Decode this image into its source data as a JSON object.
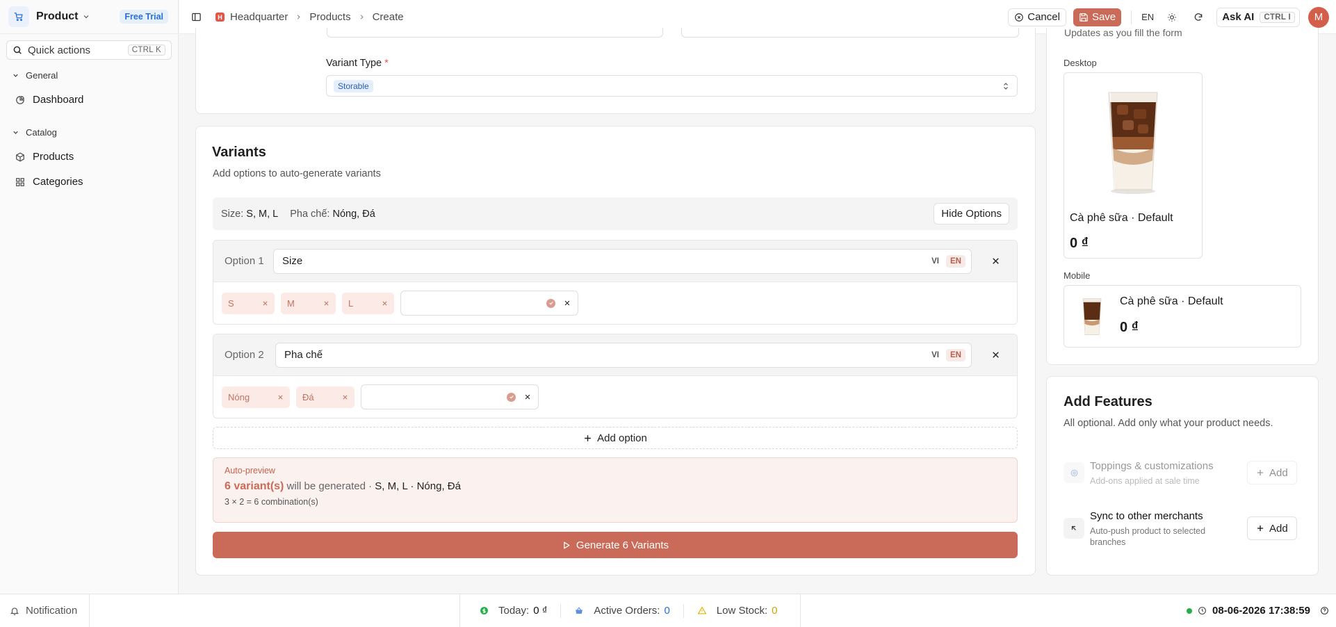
{
  "sidebar": {
    "brand": "Product",
    "trial_badge": "Free Trial",
    "quick_actions": "Quick actions",
    "quick_kbd": "CTRL K",
    "sections": [
      {
        "label": "General",
        "items": [
          {
            "label": "Dashboard",
            "icon": "pie-chart-icon"
          }
        ]
      },
      {
        "label": "Catalog",
        "items": [
          {
            "label": "Products",
            "icon": "box-icon"
          },
          {
            "label": "Categories",
            "icon": "grid-icon"
          }
        ]
      }
    ]
  },
  "topbar": {
    "breadcrumb": [
      "Headquarter",
      "Products",
      "Create"
    ],
    "hq_badge": "H",
    "cancel": "Cancel",
    "save": "Save",
    "lang": "EN",
    "ask_ai": "Ask AI",
    "ask_kbd": "CTRL I",
    "avatar": "M"
  },
  "form": {
    "variant_type_label": "Variant Type",
    "required_mark": "*",
    "variant_type_value": "Storable"
  },
  "variants": {
    "title": "Variants",
    "subtitle": "Add options to auto-generate variants",
    "summary": [
      {
        "name": "Size:",
        "values": "S, M, L"
      },
      {
        "name": "Pha chế:",
        "values": "Nóng, Đá"
      }
    ],
    "hide_options": "Hide Options",
    "options": [
      {
        "label": "Option 1",
        "name": "Size",
        "values": [
          "S",
          "M",
          "L"
        ]
      },
      {
        "label": "Option 2",
        "name": "Pha chế",
        "values": [
          "Nóng",
          "Đá"
        ]
      }
    ],
    "lang_tabs": [
      "VI",
      "EN"
    ],
    "add_option": "Add option",
    "preview": {
      "title": "Auto-preview",
      "count": "6 variant(s)",
      "middle": "will be generated ·",
      "values": "S, M, L · Nóng, Đá",
      "calc": "3 × 2 = 6 combination(s)"
    },
    "generate": "Generate 6 Variants"
  },
  "preview_panel": {
    "caption": "Updates as you fill the form",
    "desktop_label": "Desktop",
    "mobile_label": "Mobile",
    "product_name": "Cà phê sữa · Default",
    "price": "0 ₫"
  },
  "features": {
    "title": "Add Features",
    "subtitle": "All optional. Add only what your product needs.",
    "items": [
      {
        "name": "Toppings & customizations",
        "desc": "Add-ons applied at sale time",
        "add": "Add",
        "enabled": false
      },
      {
        "name": "Sync to other merchants",
        "desc": "Auto-push product to selected branches",
        "add": "Add",
        "enabled": true
      }
    ]
  },
  "statusbar": {
    "notification": "Notification",
    "today_label": "Today:",
    "today_value": "0 ₫",
    "orders_label": "Active Orders:",
    "orders_value": "0",
    "stock_label": "Low Stock:",
    "stock_value": "0",
    "datetime": "08-06-2026 17:38:59"
  },
  "colors": {
    "accent": "#c96b58",
    "chip_bg": "#fbeae6",
    "badge_blue": "#2a6fd6",
    "online": "#22b04a"
  }
}
